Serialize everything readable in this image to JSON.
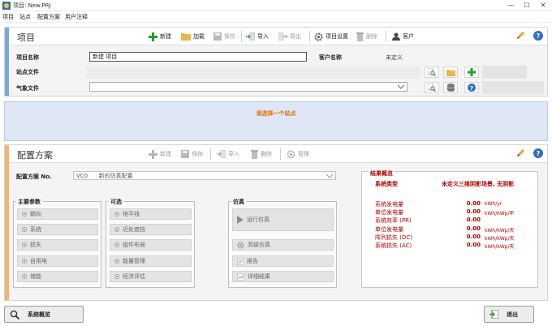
{
  "window": {
    "title": "项目: New.PRJ",
    "minimize": "—",
    "maximize": "☐",
    "close": "✕"
  },
  "menu": [
    "项目",
    "站点",
    "配置方案",
    "用户注释"
  ],
  "project": {
    "section_title": "项目",
    "toolbar": {
      "new": "新建",
      "load": "加载",
      "save": "保存",
      "import": "导入",
      "export": "导出",
      "settings": "项目设置",
      "delete": "删除",
      "client": "客户"
    },
    "name_label": "项目名称",
    "name_value": "新建 项目",
    "client_label": "客户名称",
    "client_value": "未定义",
    "site_label": "站点文件",
    "meteo_label": "气象文件"
  },
  "site_banner": "请选择一个站点",
  "config": {
    "section_title": "配置方案",
    "toolbar": {
      "new": "新建",
      "save": "保存",
      "import": "导入",
      "delete": "删除",
      "manage": "管理"
    },
    "variant_label": "配置方案 No.",
    "variant_code": "VC0",
    "variant_name": ": 新的仿真配置",
    "main_params": {
      "title": "主要参数",
      "items": [
        "朝向",
        "系统",
        "损失",
        "自用电",
        "储能"
      ]
    },
    "optional": {
      "title": "可选",
      "items": [
        "地平线",
        "近处遮挡",
        "组件布局",
        "能量管理",
        "经济评估"
      ]
    },
    "simulation": {
      "title": "仿真",
      "run": "运行仿真",
      "advanced": "高级仿真",
      "report": "报告",
      "details": "详细结果"
    }
  },
  "summary": {
    "title": "结果概览",
    "system_type_label": "系统类型",
    "system_type_value": "未定义三维阴影场景, 无阴影",
    "rows": [
      {
        "label": "系统发电量",
        "value": "0.00",
        "unit": "kWh/yr"
      },
      {
        "label": "单位发电量",
        "value": "0.00",
        "unit": "kWh/kWp/年"
      },
      {
        "label": "系统效率 (PR)",
        "value": "0.00",
        "unit": ""
      },
      {
        "label": "单位发电量",
        "value": "0.00",
        "unit": "kWh/kWp/天"
      },
      {
        "label": "阵列损失 (DC)",
        "value": "0.00",
        "unit": "kWh/kWp/天"
      },
      {
        "label": "系统损失 (AC)",
        "value": "0.00",
        "unit": "kWh/kWp/天"
      }
    ]
  },
  "footer": {
    "overview": "系统概览",
    "exit": "退出"
  },
  "colors": {
    "accent_blue": "#7aa9d9",
    "accent_orange": "#f3b56a",
    "banner_bg": "#dfe7f7",
    "banner_text": "#e07000",
    "summary_red": "#b00000"
  }
}
